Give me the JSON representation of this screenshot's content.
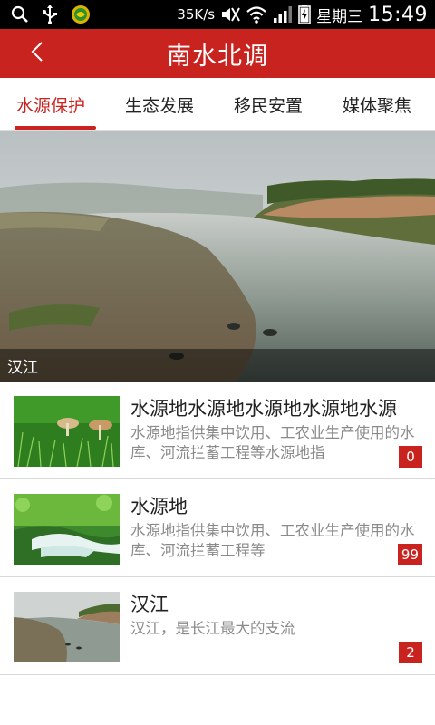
{
  "status_bar": {
    "speed": "35K/s",
    "carrier": "星期三",
    "time": "15:49"
  },
  "header": {
    "title": "南水北调"
  },
  "tabs": [
    {
      "label": "水源保护"
    },
    {
      "label": "生态发展"
    },
    {
      "label": "移民安置"
    },
    {
      "label": "媒体聚焦"
    }
  ],
  "active_tab": "水源保护",
  "banner": {
    "caption": "汉江"
  },
  "list": [
    {
      "title": "水源地水源地水源地水源地水源",
      "desc": "水源地指供集中饮用、工农业生产使用的水库、河流拦蓄工程等水源地指",
      "count": "0"
    },
    {
      "title": "水源地",
      "desc": "水源地指供集中饮用、工农业生产使用的水库、河流拦蓄工程等",
      "count": "99"
    },
    {
      "title": "汉江",
      "desc": "汉江，是长江最大的支流",
      "count": "2"
    }
  ],
  "colors": {
    "brand_red": "#c8231f",
    "status_bar": "#000000"
  }
}
